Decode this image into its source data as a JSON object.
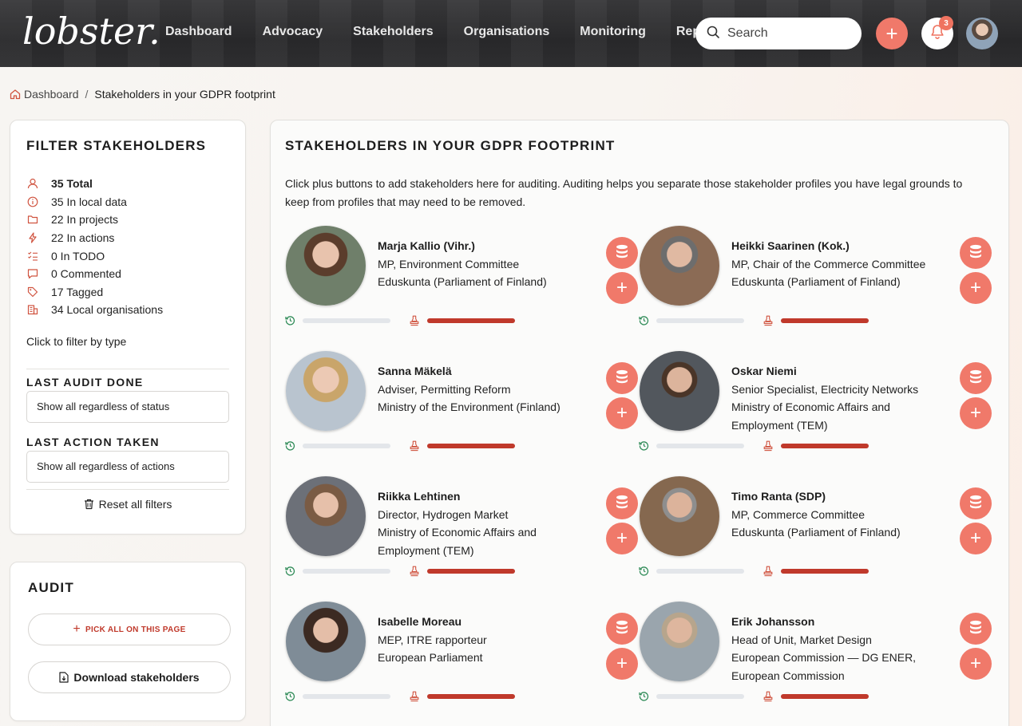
{
  "app": {
    "logo": "lobster."
  },
  "nav": {
    "items": [
      "Dashboard",
      "Advocacy",
      "Stakeholders",
      "Organisations",
      "Monitoring",
      "Reports"
    ],
    "search_placeholder": "Search",
    "notifications_count": "3"
  },
  "breadcrumb": {
    "home": "Dashboard",
    "separator": "/",
    "current": "Stakeholders in your GDPR footprint"
  },
  "filter": {
    "title": "FILTER STAKEHOLDERS",
    "stats": [
      {
        "label": "35 Total",
        "icon": "person-icon"
      },
      {
        "label": "35 In local data",
        "icon": "info-icon"
      },
      {
        "label": "22 In projects",
        "icon": "folder-icon"
      },
      {
        "label": "22 In actions",
        "icon": "bolt-icon"
      },
      {
        "label": "0 In TODO",
        "icon": "checklist-icon"
      },
      {
        "label": "0 Commented",
        "icon": "comment-icon"
      },
      {
        "label": "17 Tagged",
        "icon": "tag-icon"
      },
      {
        "label": "34 Local organisations",
        "icon": "building-icon"
      }
    ],
    "hint": "Click to filter by type",
    "last_audit_title": "LAST AUDIT DONE",
    "last_audit_value": "Show all regardless of status",
    "last_action_title": "LAST ACTION TAKEN",
    "last_action_value": "Show all regardless of actions",
    "reset_label": "Reset all filters"
  },
  "audit": {
    "title": "AUDIT",
    "pick_label": "PICK ALL ON THIS PAGE",
    "download_label": "Download stakeholders"
  },
  "main": {
    "title": "STAKEHOLDERS IN YOUR GDPR FOOTPRINT",
    "intro": "Click plus buttons to add stakeholders here for auditing. Auditing helps you separate those stakeholder profiles you have legal grounds to keep from profiles that may need to be removed.",
    "stakeholders": [
      {
        "name": "Marja Kallio (Vihr.)",
        "role": "MP, Environment Committee",
        "org": "Eduskunta (Parliament of Finland)",
        "history_level": 0.0,
        "action_level": 1.0
      },
      {
        "name": "Heikki Saarinen (Kok.)",
        "role": "MP, Chair of the Commerce Committee",
        "org": "Eduskunta (Parliament of Finland)",
        "history_level": 0.0,
        "action_level": 1.0
      },
      {
        "name": "Sanna Mäkelä",
        "role": "Adviser, Permitting Reform",
        "org": "Ministry of the Environment (Finland)",
        "history_level": 0.0,
        "action_level": 1.0
      },
      {
        "name": "Oskar Niemi",
        "role": "Senior Specialist, Electricity Networks",
        "org": "Ministry of Economic Affairs and Employment (TEM)",
        "history_level": 0.0,
        "action_level": 1.0
      },
      {
        "name": "Riikka Lehtinen",
        "role": "Director, Hydrogen Market",
        "org": "Ministry of Economic Affairs and Employment (TEM)",
        "history_level": 0.0,
        "action_level": 1.0
      },
      {
        "name": "Timo Ranta (SDP)",
        "role": "MP, Commerce Committee",
        "org": "Eduskunta (Parliament of Finland)",
        "history_level": 0.0,
        "action_level": 1.0
      },
      {
        "name": "Isabelle Moreau",
        "role": "MEP, ITRE rapporteur",
        "org": "European Parliament",
        "history_level": 0.0,
        "action_level": 1.0
      },
      {
        "name": "Erik Johansson",
        "role": "Head of Unit, Market Design",
        "org": "European Commission — DG ENER, European Commission",
        "history_level": 0.0,
        "action_level": 1.0
      }
    ]
  },
  "colors": {
    "accent": "#f0796a",
    "danger_bar": "#c0392b",
    "track": "#e3e6ea",
    "history_icon": "#2e8b57"
  }
}
